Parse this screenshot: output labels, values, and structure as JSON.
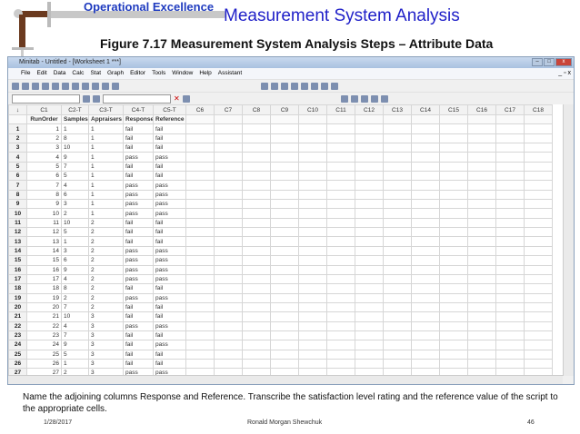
{
  "slide": {
    "brand": "Operational Excellence",
    "title": "Measurement System Analysis",
    "subtitle": "Figure 7.17  Measurement System Analysis Steps – Attribute Data",
    "instruction": "Name the adjoining columns Response and Reference.  Transcribe the satisfaction level rating and the reference value of the script to the appropriate cells.",
    "date": "1/28/2017",
    "author": "Ronald Morgan Shewchuk",
    "page": "46"
  },
  "window": {
    "title": "Minitab - Untitled - [Worksheet 1 ***]",
    "menu": [
      "File",
      "Edit",
      "Data",
      "Calc",
      "Stat",
      "Graph",
      "Editor",
      "Tools",
      "Window",
      "Help",
      "Assistant"
    ]
  },
  "worksheet": {
    "columns": [
      "C1",
      "C2-T",
      "C3-T",
      "C4-T",
      "C5-T",
      "C6",
      "C7",
      "C8",
      "C9",
      "C10",
      "C11",
      "C12",
      "C13",
      "C14",
      "C15",
      "C16",
      "C17",
      "C18"
    ],
    "names": [
      "RunOrder",
      "Samples",
      "Appraisers",
      "Response",
      "Reference"
    ],
    "rows": [
      [
        "1",
        "1",
        "1",
        "fail",
        "fail"
      ],
      [
        "2",
        "8",
        "1",
        "fail",
        "fail"
      ],
      [
        "3",
        "10",
        "1",
        "fail",
        "fail"
      ],
      [
        "4",
        "9",
        "1",
        "pass",
        "pass"
      ],
      [
        "5",
        "7",
        "1",
        "fail",
        "fail"
      ],
      [
        "6",
        "5",
        "1",
        "fail",
        "fail"
      ],
      [
        "7",
        "4",
        "1",
        "pass",
        "pass"
      ],
      [
        "8",
        "6",
        "1",
        "pass",
        "pass"
      ],
      [
        "9",
        "3",
        "1",
        "pass",
        "pass"
      ],
      [
        "10",
        "2",
        "1",
        "pass",
        "pass"
      ],
      [
        "11",
        "10",
        "2",
        "fail",
        "fail"
      ],
      [
        "12",
        "5",
        "2",
        "fail",
        "fail"
      ],
      [
        "13",
        "1",
        "2",
        "fail",
        "fail"
      ],
      [
        "14",
        "3",
        "2",
        "pass",
        "pass"
      ],
      [
        "15",
        "6",
        "2",
        "pass",
        "pass"
      ],
      [
        "16",
        "9",
        "2",
        "pass",
        "pass"
      ],
      [
        "17",
        "4",
        "2",
        "pass",
        "pass"
      ],
      [
        "18",
        "8",
        "2",
        "fail",
        "fail"
      ],
      [
        "19",
        "2",
        "2",
        "pass",
        "pass"
      ],
      [
        "20",
        "7",
        "2",
        "fail",
        "fail"
      ],
      [
        "21",
        "10",
        "3",
        "fail",
        "fail"
      ],
      [
        "22",
        "4",
        "3",
        "pass",
        "pass"
      ],
      [
        "23",
        "7",
        "3",
        "fail",
        "fail"
      ],
      [
        "24",
        "9",
        "3",
        "fail",
        "pass"
      ],
      [
        "25",
        "5",
        "3",
        "fail",
        "fail"
      ],
      [
        "26",
        "1",
        "3",
        "fail",
        "fail"
      ],
      [
        "27",
        "2",
        "3",
        "pass",
        "pass"
      ]
    ]
  }
}
